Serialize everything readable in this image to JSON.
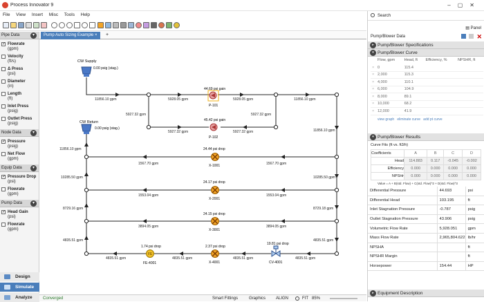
{
  "app": {
    "title": "Process Innovator 9"
  },
  "menu": [
    "File",
    "View",
    "Insert",
    "Misc",
    "Tools",
    "Help"
  ],
  "search": {
    "placeholder": "Search"
  },
  "panel_label": "Panel",
  "left_panel": {
    "pipe_section": "Pipe Data",
    "pipe_items": [
      {
        "label": "Flowrate",
        "unit": "(gpm)",
        "checked": true
      },
      {
        "label": "Velocity",
        "unit": "(ft/s)",
        "checked": false
      },
      {
        "label": "Δ Press",
        "unit": "(psi)",
        "checked": false
      },
      {
        "label": "Diameter",
        "unit": "(in)",
        "checked": false
      },
      {
        "label": "Length",
        "unit": "(ft)",
        "checked": false
      },
      {
        "label": "Inlet Press",
        "unit": "(psig)",
        "checked": false
      },
      {
        "label": "Outlet Press",
        "unit": "(psig)",
        "checked": false
      }
    ],
    "node_section": "Node Data",
    "node_items": [
      {
        "label": "Pressure",
        "unit": "(psig)",
        "checked": true
      },
      {
        "label": "Net Flow",
        "unit": "(gpm)",
        "checked": false
      }
    ],
    "equip_section": "Equip Data",
    "equip_items": [
      {
        "label": "Pressure Drop",
        "unit": "(psi)",
        "checked": true
      },
      {
        "label": "Flowrate",
        "unit": "(gpm)",
        "checked": false
      }
    ],
    "pump_section": "Pump Data",
    "pump_items": [
      {
        "label": "Head Gain",
        "unit": "(psi)",
        "checked": true
      },
      {
        "label": "Flowrate",
        "unit": "(gpm)",
        "checked": false
      }
    ],
    "nav": {
      "design": "Design",
      "simulate": "Simulate",
      "analyze": "Analyze"
    }
  },
  "tabs": {
    "active": "Pump Auto Sizing Example",
    "add": "+"
  },
  "diagram": {
    "supply": {
      "name": "CW Supply",
      "pressure": "0.00 psig (stag.)"
    },
    "return": {
      "name": "CW Return",
      "pressure": "0.00 psig (stag.)"
    },
    "pump1": {
      "name": "P-101",
      "label": "44.69 psi gain"
    },
    "pump2": {
      "name": "P-102",
      "label": "45.42 psi gain"
    },
    "pipes": {
      "p_supply": "11856.10 gpm",
      "p_a": "5928.05 gpm",
      "p_b": "5928.05 gpm",
      "p_c": "5927.32 gpm",
      "p_d": "5927.32 gpm",
      "p_e": "5927.32 gpm",
      "p_f": "5927.32 gpm",
      "p_out": "11856.10 gpm",
      "p_down1": "11856.10 gpm",
      "p_left_return": "11856.10 gpm",
      "p_left2": "10285.50 gpm",
      "p_right2": "10285.50 gpm",
      "x1001_l": "1567.70 gpm",
      "x1001_r": "1567.70 gpm",
      "x2001_l": "1553.04 gpm",
      "x2001_r": "1553.04 gpm",
      "p_left3": "8729.16 gpm",
      "p_right3": "8729.18 gpm",
      "x3001_l": "3894.05 gpm",
      "x3001_r": "3894.05 gpm",
      "p_left4": "4835.51 gpm",
      "p_right4": "4835.51 gpm",
      "b1": "4835.51 gpm",
      "b2": "4835.51 gpm",
      "b3": "4835.51 gpm",
      "b4": "4835.51 gpm"
    },
    "x1001": {
      "name": "X-1001",
      "label": "24.44 psi drop"
    },
    "x2001": {
      "name": "X-2001",
      "label": "24.17 psi drop"
    },
    "x3001": {
      "name": "X-3001",
      "label": "24.15 psi drop"
    },
    "x4001": {
      "name": "X-4001",
      "label": "2.37 psi drop"
    },
    "fe4001": {
      "name": "FE-4001",
      "label": "1.74 psi drop"
    },
    "cv4001": {
      "name": "CV-4001",
      "label": "19.81 psi drop"
    }
  },
  "status": {
    "text": "Converged",
    "smart_fittings": "Smart Fittings",
    "graphics": "Graphics",
    "align": "ALIGN",
    "fit": "FIT",
    "zoom": "85%"
  },
  "right_panel": {
    "title": "Pump/Blower Data",
    "specs": "Pump/Blower Specifications",
    "curve": "Pump/Blower Curve",
    "curve_cols": [
      "Flow, gpm",
      "Head, ft",
      "Efficiency, %",
      "NPSHR, ft"
    ],
    "curve_rows": [
      [
        "0",
        "115.4",
        "",
        ""
      ],
      [
        "2,000",
        "115.3",
        "",
        ""
      ],
      [
        "4,000",
        "110.1",
        "",
        ""
      ],
      [
        "6,000",
        "104.9",
        "",
        ""
      ],
      [
        "8,000",
        "89.1",
        "",
        ""
      ],
      [
        "10,000",
        "68.2",
        "",
        ""
      ],
      [
        "12,000",
        "41.9",
        "",
        ""
      ]
    ],
    "curve_actions": [
      "view graph",
      "eliminate curve",
      "add pt curve"
    ],
    "results": "Pump/Blower Results",
    "curve_fits": "Curve Fits (ft vs. ft3/h)",
    "coef_cols": [
      "Coefficients",
      "A",
      "B",
      "C",
      "D"
    ],
    "coef_rows": [
      [
        "Head",
        "114.883",
        "0.117",
        "-0.045",
        "-0.002"
      ],
      [
        "Efficiency",
        "0.000",
        "0.000",
        "0.000",
        "0.000"
      ],
      [
        "NPSHr",
        "0.000",
        "0.000",
        "0.000",
        "0.000"
      ]
    ],
    "coef_note": "Value = A + B(std. Flow) + C(std. Flow)^2 + D(std. Flow)^3",
    "result_rows": [
      [
        "Differential Pressure",
        "44.693",
        "psi"
      ],
      [
        "Differential Head",
        "103.195",
        "ft"
      ],
      [
        "Inlet Stagnation Pressure",
        "-0.787",
        "psig"
      ],
      [
        "Outlet Stagnation Pressure",
        "43.906",
        "psig"
      ],
      [
        "Volumetric Flow Rate",
        "5,928.051",
        "gpm"
      ],
      [
        "Mass Flow Rate",
        "2,965,804.622",
        "lb/hr"
      ],
      [
        "NPSHA",
        "",
        "ft"
      ],
      [
        "NPSHR Margin",
        "",
        "ft"
      ],
      [
        "Horsepower",
        "154.44",
        "HP"
      ]
    ],
    "equipment": "Equipment Description"
  },
  "colors": {
    "accent": "#4a7ebb",
    "pump_red": "#d9534f",
    "valve_orange": "#f2a427",
    "pipe": "#222222"
  }
}
